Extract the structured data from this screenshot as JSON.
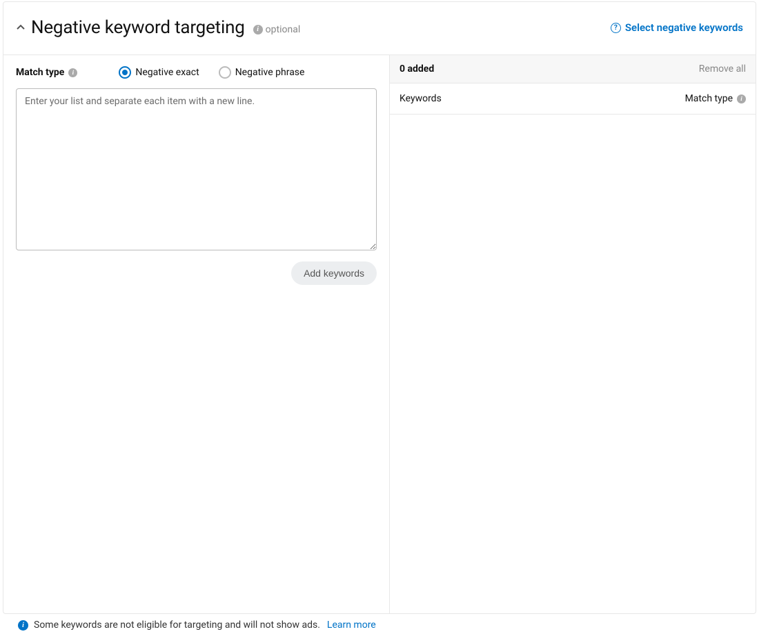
{
  "header": {
    "title": "Negative keyword targeting",
    "optional_label": "optional",
    "select_link": "Select negative keywords"
  },
  "left": {
    "match_type_label": "Match type",
    "radio_exact": "Negative exact",
    "radio_phrase": "Negative phrase",
    "textarea_placeholder": "Enter your list and separate each item with a new line.",
    "add_button": "Add keywords"
  },
  "right": {
    "added_count": "0 added",
    "remove_all": "Remove all",
    "col_keywords": "Keywords",
    "col_match_type": "Match type"
  },
  "footer": {
    "note": "Some keywords are not eligible for targeting and will not show ads.",
    "learn_more": "Learn more"
  }
}
